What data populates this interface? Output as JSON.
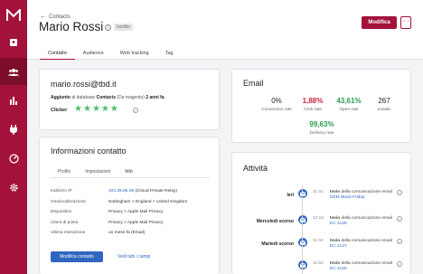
{
  "header": {
    "back_label": "Contacts",
    "contact_name": "Mario Rossi",
    "status_badge": "Iscritto",
    "edit_button": "Modifica",
    "more_button": "···"
  },
  "tabs": [
    {
      "label": "Contatto",
      "active": true
    },
    {
      "label": "Audience",
      "active": false
    },
    {
      "label": "Web tracking",
      "active": false
    },
    {
      "label": "Tag",
      "active": false
    }
  ],
  "summary": {
    "email": "mario.rossi@tbd.it",
    "added_prefix": "Aggiunto",
    "added_middle": "al database",
    "added_db": "Contacts",
    "added_source": "(Da magento)",
    "added_time": "2 anni fa",
    "clicker_label": "Clicker",
    "stars": 5,
    "star_glyph": "★"
  },
  "info": {
    "title": "Informazioni contatto",
    "sub_tabs": [
      {
        "label": "Profilo",
        "active": false
      },
      {
        "label": "Impostazioni",
        "active": false
      },
      {
        "label": "Info",
        "active": true
      }
    ],
    "rows": [
      {
        "key": "Indirizzo IP",
        "value_link": "104.28.86.49",
        "value": " (iCloud Private Relay)"
      },
      {
        "key": "Geolocalizzazione",
        "value_link": "",
        "value": "Nottingham > England > United Kingdom"
      },
      {
        "key": "Dispositivo",
        "value_link": "",
        "value": "Privacy > Apple Mail Privacy"
      },
      {
        "key": "Client di posta",
        "value_link": "",
        "value": "Privacy > Apple Mail Privacy"
      },
      {
        "key": "Ultima interazione",
        "value_link": "",
        "value": "un mese fa (Email)"
      }
    ],
    "edit_button": "Modifica contatto",
    "all_fields_link": "Vedi tutti i campi"
  },
  "email_stats": {
    "title": "Email",
    "stats": [
      {
        "value": "0%",
        "label": "Conversion rate",
        "color": "#222222"
      },
      {
        "value": "1,88%",
        "label": "Click rate",
        "color": "#c8283e"
      },
      {
        "value": "43,61%",
        "label": "Open rate",
        "color": "#2e9b4f"
      },
      {
        "value": "267",
        "label": "Inviate",
        "color": "#222222"
      },
      {
        "value": "99,63%",
        "label": "Delivery rate",
        "color": "#2e9b4f"
      }
    ]
  },
  "activity": {
    "title": "Attività",
    "items": [
      {
        "day": "Ieri",
        "time": "11:31",
        "action": "Invio",
        "text": " della comunicazione email ",
        "campaign": "DEM Black Friday"
      },
      {
        "day": "Mercoledì scorso",
        "time": "12:10",
        "action": "Invio",
        "text": " della comunicazione email ",
        "campaign": "EC 4128"
      },
      {
        "day": "Martedì scorso",
        "time": "11:04",
        "action": "Invio",
        "text": " della comunicazione email ",
        "campaign": "EC 4127"
      },
      {
        "day": "",
        "time": "11:50",
        "action": "Invio",
        "text": " della comunicazione email ",
        "campaign": "EC 4126"
      }
    ]
  },
  "colors": {
    "brand": "#a3123a",
    "link": "#2f66c2",
    "positive": "#2e9b4f",
    "negative": "#c8283e"
  },
  "sidebar": {
    "icons": [
      "logo-icon",
      "contacts-book-icon",
      "audience-icon",
      "stats-icon",
      "automation-icon",
      "speed-icon",
      "settings-icon"
    ]
  }
}
